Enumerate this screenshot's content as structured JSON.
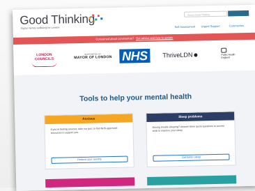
{
  "header": {
    "brand": "Good Thinking",
    "tagline": "Digital mental wellbeing for London",
    "search_placeholder": "Search Good Thinking",
    "nav": [
      "Self Assessment",
      "Urgent Support",
      "Coronavirus"
    ]
  },
  "banner": {
    "text": "Concerned about coronavirus?",
    "link": "Get advice and how to update"
  },
  "logos": {
    "london_councils": [
      "LONDON",
      "COUNCILS"
    ],
    "mayor_small": "SUPPORTED BY",
    "mayor_big": "MAYOR OF LONDON",
    "nhs": "NHS",
    "thrive": "Thrive",
    "thrive_ldn": "LDN",
    "phe": [
      "Public Health",
      "England"
    ]
  },
  "main": {
    "heading": "Tools to help your mental health",
    "cards": [
      {
        "title": "Anxious",
        "text": "If you're feeling anxious, take our quiz to find NHS-approved resources to support you.",
        "button": "Reduce your anxiety"
      },
      {
        "title": "Sleep problems",
        "text": "Having trouble sleeping? Answer three quick questions to access tools to improve your sleep.",
        "button": "Get better sleep"
      }
    ]
  },
  "colors": {
    "banner": "#e25656",
    "nhs_blue": "#005eb8",
    "heading": "#1d5a8a",
    "anxious": "#f5a623",
    "sleep": "#2c3e66",
    "link": "#1f73c1"
  },
  "icons": [
    "sparkle-logo-icon",
    "public-health-crest-icon",
    "thrive-dot-icon"
  ]
}
